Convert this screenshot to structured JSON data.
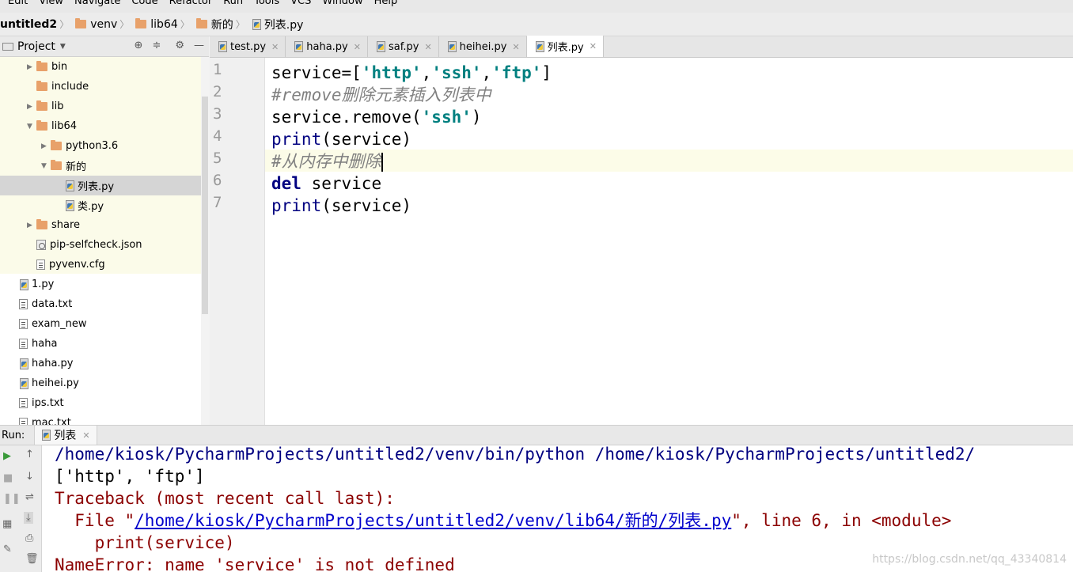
{
  "menu": [
    "Edit",
    "View",
    "Navigate",
    "Code",
    "Refactor",
    "Run",
    "Tools",
    "VCS",
    "Window",
    "Help"
  ],
  "breadcrumb": [
    "untitled2",
    "venv",
    "lib64",
    "新的",
    "列表.py"
  ],
  "project": {
    "title": "Project"
  },
  "tree": [
    {
      "label": "bin",
      "type": "folder",
      "depth": 2,
      "arrow": "right"
    },
    {
      "label": "include",
      "type": "folder",
      "depth": 2,
      "arrow": ""
    },
    {
      "label": "lib",
      "type": "folder",
      "depth": 2,
      "arrow": "right"
    },
    {
      "label": "lib64",
      "type": "folder-link",
      "depth": 2,
      "arrow": "down"
    },
    {
      "label": "python3.6",
      "type": "folder",
      "depth": 3,
      "arrow": "right"
    },
    {
      "label": "新的",
      "type": "folder",
      "depth": 3,
      "arrow": "down"
    },
    {
      "label": "列表.py",
      "type": "py",
      "depth": 4,
      "arrow": "",
      "selected": true
    },
    {
      "label": "类.py",
      "type": "py",
      "depth": 4,
      "arrow": ""
    },
    {
      "label": "share",
      "type": "folder",
      "depth": 2,
      "arrow": "right"
    },
    {
      "label": "pip-selfcheck.json",
      "type": "cfg",
      "depth": 2,
      "arrow": ""
    },
    {
      "label": "pyvenv.cfg",
      "type": "txt",
      "depth": 2,
      "arrow": ""
    },
    {
      "label": "1.py",
      "type": "py",
      "depth": 1,
      "arrow": ""
    },
    {
      "label": "data.txt",
      "type": "txt",
      "depth": 1,
      "arrow": ""
    },
    {
      "label": "exam_new",
      "type": "txt",
      "depth": 1,
      "arrow": ""
    },
    {
      "label": "haha",
      "type": "txt",
      "depth": 1,
      "arrow": ""
    },
    {
      "label": "haha.py",
      "type": "py",
      "depth": 1,
      "arrow": ""
    },
    {
      "label": "heihei.py",
      "type": "py",
      "depth": 1,
      "arrow": ""
    },
    {
      "label": "ips.txt",
      "type": "txt",
      "depth": 1,
      "arrow": ""
    },
    {
      "label": "mac.txt",
      "type": "txt",
      "depth": 1,
      "arrow": ""
    }
  ],
  "tabs": [
    {
      "label": "test.py",
      "active": false
    },
    {
      "label": "haha.py",
      "active": false
    },
    {
      "label": "saf.py",
      "active": false
    },
    {
      "label": "heihei.py",
      "active": false
    },
    {
      "label": "列表.py",
      "active": true
    }
  ],
  "code": {
    "numbers": [
      "1",
      "2",
      "3",
      "4",
      "5",
      "6",
      "7"
    ],
    "l1_a": "service=[",
    "l1_s1": "'http'",
    "l1_c1": ",",
    "l1_s2": "'ssh'",
    "l1_c2": ",",
    "l1_s3": "'ftp'",
    "l1_b": "]",
    "l2": "#remove删除元素插入列表中",
    "l3_a": "service.remove(",
    "l3_s": "'ssh'",
    "l3_b": ")",
    "l4_fn": "print",
    "l4_b": "(service)",
    "l5": "#从内存中删除",
    "l6_kw": "del",
    "l6_b": " service",
    "l7_fn": "print",
    "l7_b": "(service)"
  },
  "run": {
    "label": "Run:",
    "tab": "列表",
    "output": {
      "cmd": "/home/kiosk/PycharmProjects/untitled2/venv/bin/python /home/kiosk/PycharmProjects/untitled2/",
      "result": "['http', 'ftp']",
      "tb_head": "Traceback (most recent call last):",
      "file_pre": "  File \"",
      "file_link": "/home/kiosk/PycharmProjects/untitled2/venv/lib64/新的/列表.py",
      "file_post": "\", line 6, in <module>",
      "stmt": "    print(service)",
      "error": "NameError: name 'service' is not defined"
    }
  },
  "watermark": "https://blog.csdn.net/qq_43340814"
}
